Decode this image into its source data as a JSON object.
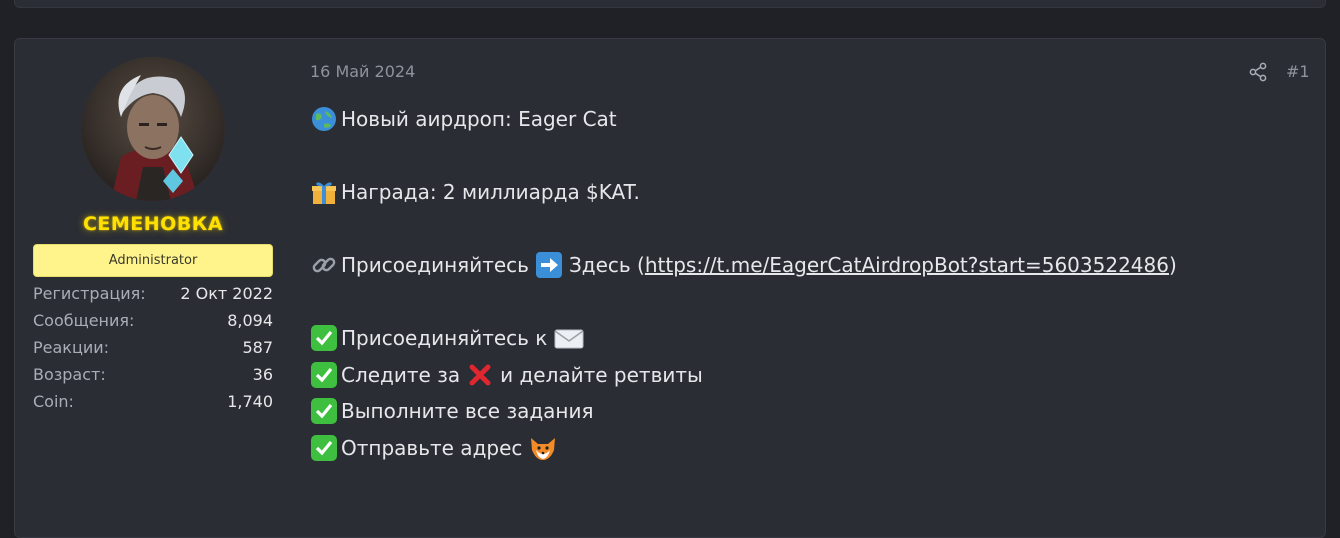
{
  "user": {
    "name": "СЕМЕНОВКА",
    "role": "Administrator",
    "stats": [
      {
        "label": "Регистрация:",
        "value": "2 Окт 2022"
      },
      {
        "label": "Сообщения:",
        "value": "8,094"
      },
      {
        "label": "Реакции:",
        "value": "587"
      },
      {
        "label": "Возраст:",
        "value": "36"
      },
      {
        "label": "Coin:",
        "value": "1,740"
      }
    ]
  },
  "post": {
    "date": "16 Май 2024",
    "number": "#1",
    "lines": {
      "l1": "Новый аирдроп: Eager Cat",
      "l2": "Награда: 2 миллиарда $KAT.",
      "l3_pre": "Присоединяйтесь",
      "l3_mid": "Здесь (",
      "l3_link": "https://t.me/EagerCatAirdropBot?start=5603522486",
      "l3_post": ")",
      "l4": "Присоединяйтесь к",
      "l5_pre": "Следите за",
      "l5_post": "и делайте ретвиты",
      "l6": "Выполните все задания",
      "l7": "Отправьте адрес"
    }
  },
  "icons": {
    "globe": "globe-icon",
    "gift": "gift-icon",
    "link": "link-icon",
    "arrow": "arrow-right-icon",
    "check": "check-mark-icon",
    "mail": "envelope-icon",
    "x": "cross-mark-icon",
    "fox": "fox-icon",
    "share": "share-icon"
  },
  "colors": {
    "username": "#ffe000",
    "role_badge": "#fff48c",
    "check": "#3fbf3f",
    "cross": "#e0262f"
  }
}
